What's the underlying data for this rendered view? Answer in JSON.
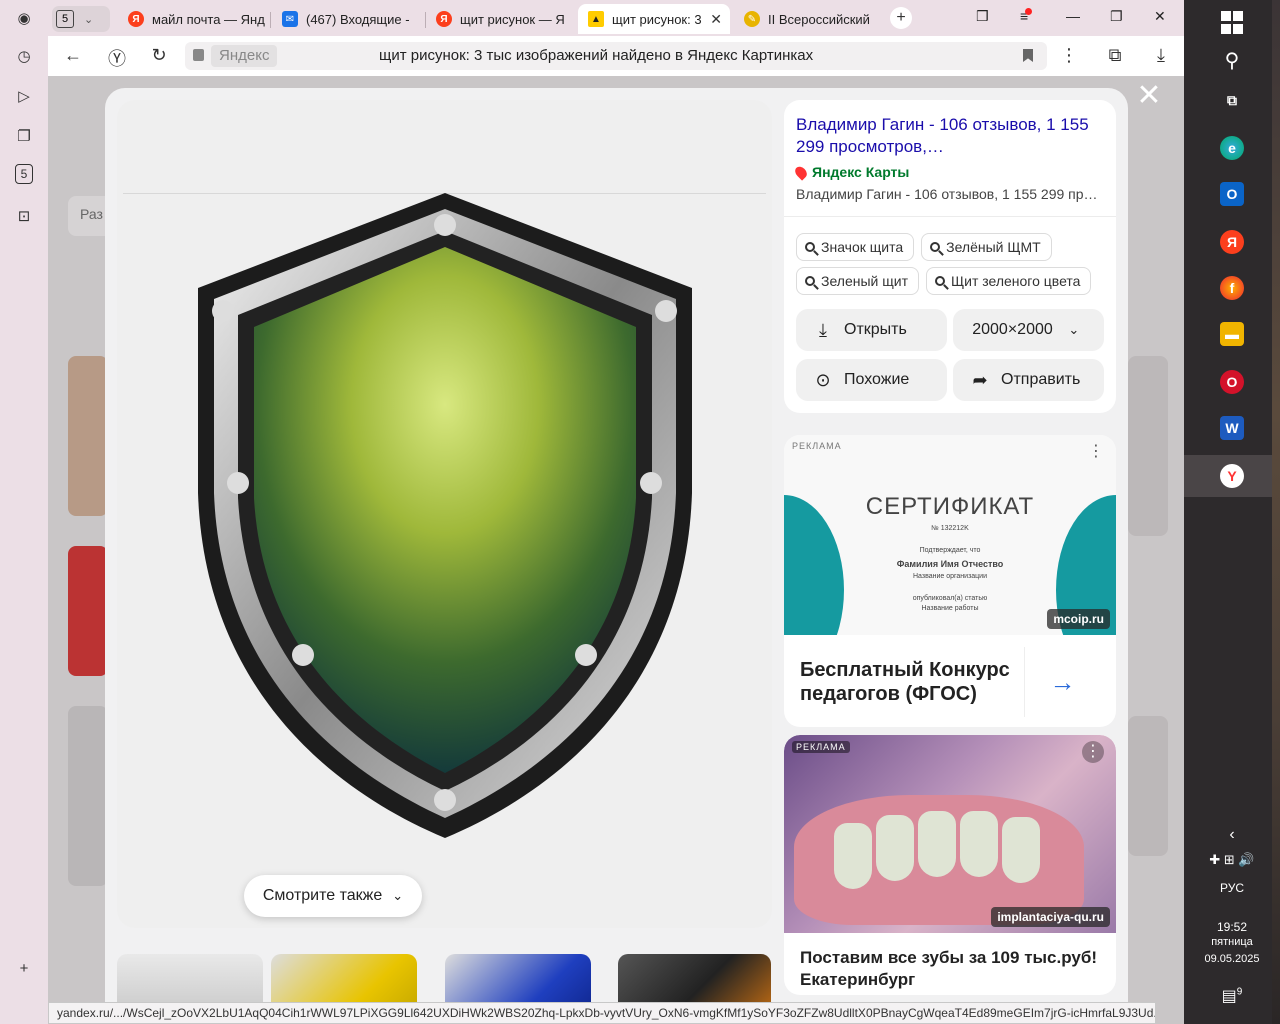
{
  "browser": {
    "tab_count": "5",
    "tabs": [
      {
        "title": "майл почта — Янд",
        "favicon": "yandex-icon",
        "color": "#fc3f1d",
        "glyph": "Я"
      },
      {
        "title": "(467) Входящие -",
        "favicon": "mail-icon",
        "color": "#1a73e8",
        "glyph": "✉"
      },
      {
        "title": "щит рисунок — Я",
        "favicon": "yandex-icon",
        "color": "#fc3f1d",
        "glyph": "Я"
      },
      {
        "title": "щит рисунок: 3",
        "favicon": "yandex-images-icon",
        "color": "#ffcc00",
        "glyph": "▲"
      },
      {
        "title": "II Всероссийский",
        "favicon": "site-icon",
        "color": "#e8b400",
        "glyph": "✎"
      }
    ],
    "address": {
      "host": "Яндекс",
      "title": "щит рисунок: 3 тыс изображений найдено в Яндекс Картинках"
    },
    "status_url": "yandex.ru/.../WsCejl_zOoVX2LbU1AqQ04Cih1rWWL97LPiXGG9Ll642UXDiHWk2WBS20Zhq-LpkxDb-vyvtVUry_OxN6-vmgKfMf1ySoYF3oZFZw8UdlltX0PBnayCgWqeaT4Ed89meGEIm7jrG-icHmrfaL9J3Ud..."
  },
  "page_bg": {
    "fragment_label": "Раз"
  },
  "modal": {
    "source": {
      "title": "Владимир Гагин - 106 отзывов, 1 155 299 просмотров,…",
      "site": "Яндекс Карты",
      "description": "Владимир Гагин - 106 отзывов, 1 155 299 пр…"
    },
    "chips": [
      "Значок щита",
      "Зелёный ЩМТ",
      "Зеленый щит",
      "Щит зеленого цвета"
    ],
    "actions": {
      "open": "Открыть",
      "size": "2000×2000",
      "similar": "Похожие",
      "share": "Отправить"
    },
    "ad1": {
      "tag": "РЕКЛАМА",
      "cert_title": "СЕРТИФИКАТ",
      "cert_number": "№ 132212K",
      "cert_confirm": "Подтверждает, что",
      "cert_name": "Фамилия Имя Отчество",
      "cert_org": "Название организации",
      "cert_pub": "опубликовал(а) статью",
      "cert_work": "Название работы",
      "domain": "mcoip.ru",
      "headline": "Бесплатный Конкурс педагогов (ФГОС)"
    },
    "ad2": {
      "tag": "РЕКЛАМА",
      "domain": "implantaciya-qu.ru",
      "headline": "Поставим все зубы за 109 тыс.руб! Екатеринбург"
    },
    "see_also": "Смотрите также"
  },
  "taskbar": {
    "lang": "РУС",
    "time": "19:52",
    "weekday": "пятница",
    "date": "09.05.2025",
    "notifications": "9"
  },
  "colors": {
    "accent_link": "#1a0dab",
    "site_green": "#007a2c",
    "teal": "#159aa0"
  }
}
